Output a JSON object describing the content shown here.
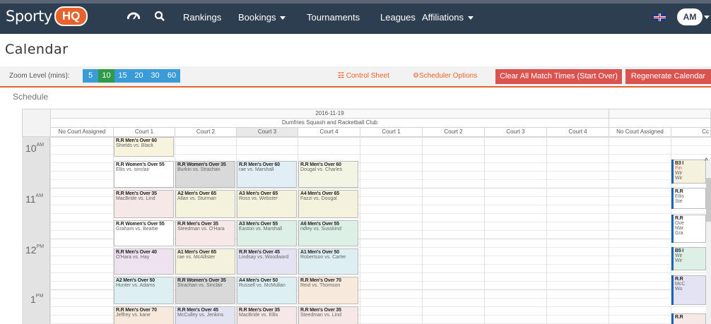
{
  "nav": {
    "brand_text": "Sporty",
    "brand_badge": "HQ",
    "rankings": "Rankings",
    "bookings": "Bookings",
    "tournaments": "Tournaments",
    "leagues": "Leagues",
    "affiliations": "Affiliations",
    "avatar": "AM"
  },
  "page_title": "Calendar",
  "toolbar": {
    "zoom_label": "Zoom Level (mins):",
    "zoom_levels": [
      "5",
      "10",
      "15",
      "20",
      "30",
      "60"
    ],
    "zoom_selected": "10",
    "control_sheet": "Control Sheet",
    "scheduler_options": "Scheduler Options",
    "clear_times": "Clear All Match Times (Start Over)",
    "regenerate": "Regenerate Calendar"
  },
  "schedule_label": "Schedule",
  "calendar": {
    "date": "2016-11-19",
    "venue": "Dumfries Squash and Racketball Club",
    "columns": [
      "No Court Assigned",
      "Court 1",
      "Court 2",
      "Court 3",
      "Court 4",
      "Court 1",
      "Court 2",
      "Court 3",
      "Court 4",
      "No Court Assigned",
      "Cc"
    ],
    "times": [
      {
        "h": "10",
        "ap": "AM"
      },
      {
        "h": "11",
        "ap": "AM"
      },
      {
        "h": "12",
        "ap": "PM"
      },
      {
        "h": "1",
        "ap": "PM"
      }
    ],
    "events": [
      {
        "col": 1,
        "row": 0,
        "title": "R.R Men's Over 60",
        "players": "Shields vs. Black",
        "color": "#f7f3dc"
      },
      {
        "col": 1,
        "row": 1,
        "title": "R.R Women's Over 55",
        "players": "Ellis vs. sinclair",
        "color": "#ffffff"
      },
      {
        "col": 2,
        "row": 1,
        "title": "R.R Women's Over 35",
        "players": "Burkin vs. Strachan",
        "color": "#d9d9d9"
      },
      {
        "col": 3,
        "row": 1,
        "title": "R.R Men's Over 60",
        "players": "rae vs. Marshall",
        "color": "#e2eef6"
      },
      {
        "col": 4,
        "row": 1,
        "title": "R.R Men's Over 60",
        "players": "Dougal vs. Charles",
        "color": "#f2f5e4"
      },
      {
        "col": 1,
        "row": 2,
        "title": "R.R Men's Over 35",
        "players": "MacBride vs. Lind",
        "color": "#f5e8e6"
      },
      {
        "col": 2,
        "row": 2,
        "title": "A2 Men's Over 65",
        "players": "Allan vs. Sturman",
        "color": "#f4f1dc"
      },
      {
        "col": 3,
        "row": 2,
        "title": "A3 Men's Over 65",
        "players": "Ross vs. Webster",
        "color": "#f4f1dc"
      },
      {
        "col": 4,
        "row": 2,
        "title": "A4 Men's Over 65",
        "players": "Fazzi vs. Dougal",
        "color": "#f4f1dc"
      },
      {
        "col": 1,
        "row": 3,
        "title": "R.R Women's Over 55",
        "players": "Graham vs. Beattie",
        "color": "#ffffff"
      },
      {
        "col": 2,
        "row": 3,
        "title": "R.R Men's Over 35",
        "players": "Steedman vs. O'Hara",
        "color": "#f5e8e6"
      },
      {
        "col": 3,
        "row": 3,
        "title": "A3 Men's Over 55",
        "players": "Easton vs. Marshall",
        "color": "#ddf0e6"
      },
      {
        "col": 4,
        "row": 3,
        "title": "A6 Men's Over 55",
        "players": "ridley vs. Susskind",
        "color": "#ddf0e6"
      },
      {
        "col": 1,
        "row": 4,
        "title": "R.R Men's Over 40",
        "players": "O'Hara vs. Hay",
        "color": "#eee2f0"
      },
      {
        "col": 2,
        "row": 4,
        "title": "A1 Men's Over 65",
        "players": "rae vs. McAllister",
        "color": "#f4f1dc"
      },
      {
        "col": 3,
        "row": 4,
        "title": "R.R Men's Over 45",
        "players": "Lindsay vs. Woodward",
        "color": "#e4e3f4"
      },
      {
        "col": 4,
        "row": 4,
        "title": "A1 Men's Over 50",
        "players": "Robertson vs. Carter",
        "color": "#ddeff2"
      },
      {
        "col": 1,
        "row": 5,
        "title": "A2 Men's Over 50",
        "players": "Hunter vs. Adams",
        "color": "#ddeff2"
      },
      {
        "col": 2,
        "row": 5,
        "title": "R.R Women's Over 35",
        "players": "Strachan vs. Sinclair",
        "color": "#d9d9d9"
      },
      {
        "col": 3,
        "row": 5,
        "title": "A4 Men's Over 50",
        "players": "Russell vs. McMullan",
        "color": "#ddeff2"
      },
      {
        "col": 4,
        "row": 5,
        "title": "R.R Men's Over 70",
        "players": "Reid vs. Thomson",
        "color": "#f7e9dc"
      },
      {
        "col": 1,
        "row": 6,
        "title": "R.R Men's Over 70",
        "players": "Jeffrey vs. kane",
        "color": "#f7e9dc"
      },
      {
        "col": 2,
        "row": 6,
        "title": "R.R Men's Over 45",
        "players": "McCulley vs. Jenkins",
        "color": "#e4e3f4"
      },
      {
        "col": 3,
        "row": 6,
        "title": "R.R Men's Over 35",
        "players": "MacBride vs. Ellis",
        "color": "#f5e8e6"
      },
      {
        "col": 4,
        "row": 6,
        "title": "R.R Men's Over 35",
        "players": "Steedman vs. Lind",
        "color": "#f5e8e6"
      }
    ],
    "right_events": [
      {
        "title": "B3 I",
        "sub1": "Fin",
        "sub2": "Wir",
        "sub3": "Wir",
        "color": "#f4f1dc"
      },
      {
        "title": "R.R",
        "sub1": "Ellis",
        "sub2": "Ste",
        "sub3": "",
        "color": "#ffffff"
      },
      {
        "title": "R.R",
        "sub1": "Ove",
        "sub2": "Mar",
        "sub3": "Gra",
        "color": "#ffffff"
      },
      {
        "title": "B5 I",
        "sub1": "Wir",
        "sub2": "Wir",
        "sub3": "",
        "color": "#ddf0e6"
      },
      {
        "title": "R.R",
        "sub1": "McC",
        "sub2": "Wo",
        "sub3": "",
        "color": "#e4e3f4"
      },
      {
        "title": "R.R",
        "sub1": "",
        "sub2": "",
        "sub3": "",
        "color": "#f5e8e6"
      }
    ]
  }
}
